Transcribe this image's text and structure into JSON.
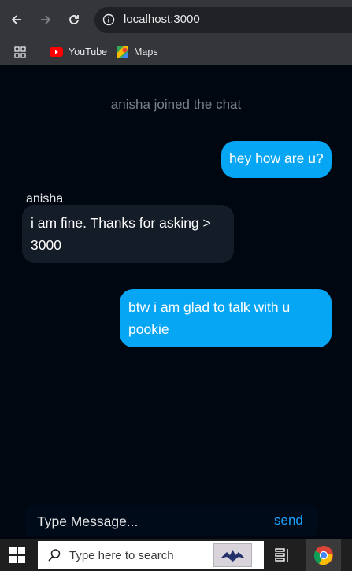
{
  "browser": {
    "url": "localhost:3000",
    "bookmarks": [
      {
        "label": "YouTube",
        "icon": "youtube-icon"
      },
      {
        "label": "Maps",
        "icon": "maps-icon"
      }
    ]
  },
  "chat": {
    "system_message": "anisha joined the chat",
    "messages": [
      {
        "direction": "outgoing",
        "text": "hey how are u?"
      },
      {
        "direction": "incoming",
        "sender": "anisha",
        "text": "i am fine. Thanks for asking > 3000"
      },
      {
        "direction": "outgoing",
        "text": "btw i am glad to talk with u pookie"
      }
    ],
    "composer": {
      "placeholder": "Type Message...",
      "send_label": "send"
    }
  },
  "taskbar": {
    "search_placeholder": "Type here to search"
  },
  "colors": {
    "outgoing_bubble": "#07a6f4",
    "incoming_bubble": "#131c27",
    "background": "#000711",
    "send": "#1aa3ff"
  }
}
